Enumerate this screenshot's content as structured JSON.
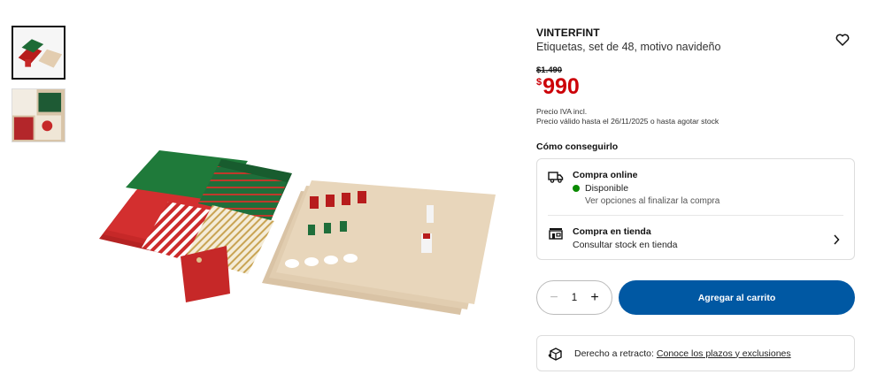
{
  "product": {
    "brand": "VINTERFINT",
    "description": "Etiquetas, set de 48, motivo navideño",
    "old_price": "$1.490",
    "price_symbol": "$",
    "price_value": "990",
    "vat_note": "Precio IVA incl.",
    "validity_note": "Precio válido hasta el 26/11/2025 o hasta agotar stock"
  },
  "icons": {
    "favorite": "heart-outline-icon",
    "online": "delivery-truck-icon",
    "store": "store-icon",
    "return": "return-box-icon",
    "chevron": "chevron-right-icon"
  },
  "availability": {
    "heading": "Cómo conseguirlo",
    "online": {
      "title": "Compra online",
      "status": "Disponible",
      "status_color": "#0a8a00",
      "note": "Ver opciones al finalizar la compra"
    },
    "store": {
      "title": "Compra en tienda",
      "note": "Consultar stock en tienda"
    }
  },
  "cart": {
    "quantity": "1",
    "minus": "−",
    "plus": "+",
    "add_label": "Agregar al carrito",
    "accent_color": "#0058a3"
  },
  "returns": {
    "label": "Derecho a retracto:",
    "link": "Conoce los plazos y exclusiones"
  }
}
